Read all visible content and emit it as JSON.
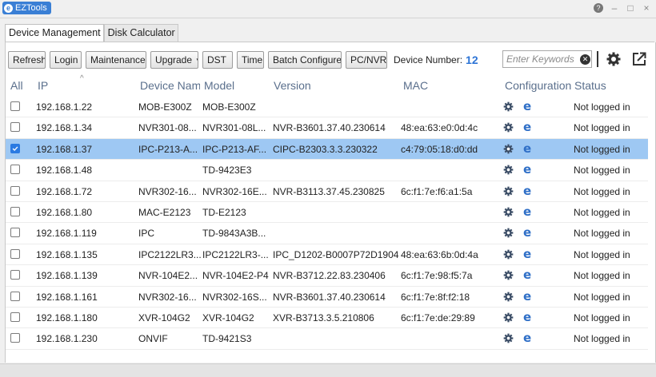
{
  "window": {
    "title": "EZTools",
    "help_glyph": "?",
    "minimize_glyph": "–",
    "maximize_glyph": "□",
    "close_glyph": "×"
  },
  "tabs": [
    {
      "label": "Device Management",
      "active": true
    },
    {
      "label": "Disk Calculator",
      "active": false
    }
  ],
  "toolbar": {
    "refresh": "Refresh",
    "login": "Login",
    "maintenance": "Maintenance",
    "upgrade": "Upgrade",
    "dst": "DST",
    "time": "Time",
    "batch_configure": "Batch Configure",
    "pc_nvr": "PC/NVR",
    "device_number_label": "Device Number:",
    "device_number_value": "12",
    "search_placeholder": "Enter Keywords"
  },
  "columns": {
    "all": "All",
    "ip": "IP",
    "device_name": "Device Name",
    "model": "Model",
    "version": "Version",
    "mac": "MAC",
    "configuration": "Configuration",
    "status": "Status"
  },
  "rows": [
    {
      "checked": false,
      "ip": "192.168.1.22",
      "name": "MOB-E300Z",
      "model": "MOB-E300Z",
      "version": "",
      "mac": "",
      "status": "Not logged in"
    },
    {
      "checked": false,
      "ip": "192.168.1.34",
      "name": "NVR301-08...",
      "model": "NVR301-08L...",
      "version": "NVR-B3601.37.40.230614",
      "mac": "48:ea:63:e0:0d:4c",
      "status": "Not logged in"
    },
    {
      "checked": true,
      "ip": "192.168.1.37",
      "name": "IPC-P213-A...",
      "model": "IPC-P213-AF...",
      "version": "CIPC-B2303.3.3.230322",
      "mac": "c4:79:05:18:d0:dd",
      "status": "Not logged in"
    },
    {
      "checked": false,
      "ip": "192.168.1.48",
      "name": "",
      "model": "TD-9423E3",
      "version": "",
      "mac": "",
      "status": "Not logged in"
    },
    {
      "checked": false,
      "ip": "192.168.1.72",
      "name": "NVR302-16...",
      "model": "NVR302-16E...",
      "version": "NVR-B3113.37.45.230825",
      "mac": "6c:f1:7e:f6:a1:5a",
      "status": "Not logged in"
    },
    {
      "checked": false,
      "ip": "192.168.1.80",
      "name": "MAC-E2123",
      "model": "TD-E2123",
      "version": "",
      "mac": "",
      "status": "Not logged in"
    },
    {
      "checked": false,
      "ip": "192.168.1.119",
      "name": "IPC",
      "model": "TD-9843A3B...",
      "version": "",
      "mac": "",
      "status": "Not logged in"
    },
    {
      "checked": false,
      "ip": "192.168.1.135",
      "name": "IPC2122LR3...",
      "model": "IPC2122LR3-...",
      "version": "IPC_D1202-B0007P72D1904",
      "mac": "48:ea:63:6b:0d:4a",
      "status": "Not logged in"
    },
    {
      "checked": false,
      "ip": "192.168.1.139",
      "name": "NVR-104E2...",
      "model": "NVR-104E2-P4",
      "version": "NVR-B3712.22.83.230406",
      "mac": "6c:f1:7e:98:f5:7a",
      "status": "Not logged in"
    },
    {
      "checked": false,
      "ip": "192.168.1.161",
      "name": "NVR302-16...",
      "model": "NVR302-16S...",
      "version": "NVR-B3601.37.40.230614",
      "mac": "6c:f1:7e:8f:f2:18",
      "status": "Not logged in"
    },
    {
      "checked": false,
      "ip": "192.168.1.180",
      "name": "XVR-104G2",
      "model": "XVR-104G2",
      "version": "XVR-B3713.3.5.210806",
      "mac": "6c:f1:7e:de:29:89",
      "status": "Not logged in"
    },
    {
      "checked": false,
      "ip": "192.168.1.230",
      "name": "ONVIF",
      "model": "TD-9421S3",
      "version": "",
      "mac": "",
      "status": "Not logged in"
    }
  ],
  "colors": {
    "accent": "#2a7ae2",
    "selected_row": "#9ec8f3",
    "header_text": "#5a6f8c",
    "ie_icon": "#2f6fc7"
  }
}
